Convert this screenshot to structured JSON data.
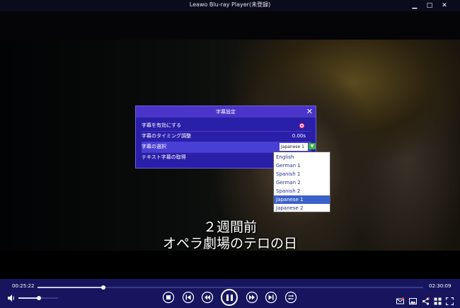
{
  "window": {
    "title": "Leawo Blu-ray Player(未登録)",
    "controls": {
      "minimize": "▁",
      "maximize": "□",
      "close": "✕"
    }
  },
  "video": {
    "subtitle_lines": [
      "２週間前",
      "オペラ劇場のテロの日"
    ]
  },
  "subtitle_dialog": {
    "title": "字幕設定",
    "close": "✕",
    "rows": {
      "enable": {
        "label": "字幕を有効にする",
        "enabled": true
      },
      "timing": {
        "label": "字幕のタイミング調整",
        "value": "0.00s"
      },
      "select": {
        "label": "字幕の選択",
        "selected": "Japanese 1",
        "arrow": "▼"
      },
      "fetch": {
        "label": "テキスト字幕の取得"
      }
    },
    "options": [
      "English",
      "German 1",
      "Spanish 1",
      "German 2",
      "Spanish 2",
      "Japanese 1",
      "Japanese 2"
    ],
    "selected_index": 5
  },
  "controls": {
    "elapsed": "00:25:22",
    "total": "02:30:09",
    "seek_fraction": 0.17,
    "volume_fraction": 0.52,
    "accent": "#16155e"
  }
}
